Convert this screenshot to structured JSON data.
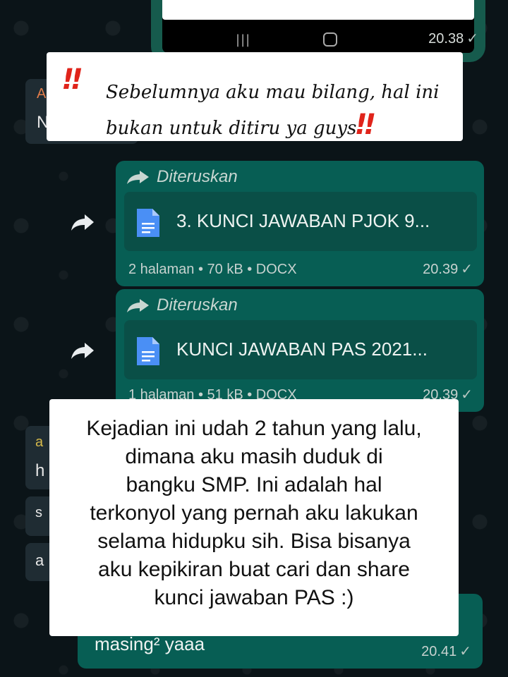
{
  "embedded_screenshot": {
    "nav_recents": "|||",
    "time": "20.38",
    "read_tick": "✓"
  },
  "incoming_fragments": {
    "top_sender_initial": "A",
    "top_text_initial": "N",
    "mid_sender_initial": "a",
    "mid_text_initial": "h",
    "lower_text_initial_1": "s",
    "lower_text_initial_2": "a"
  },
  "overlay_note_top": {
    "exclamation": "‼",
    "text_line_1": "Sebelumnya aku mau bilang, hal ini",
    "text_line_2": "bukan untuk ditiru ya guys"
  },
  "messages": [
    {
      "forwarded_label": "Diteruskan",
      "file_name": "3. KUNCI JAWABAN PJOK 9...",
      "meta": "2 halaman • 70 kB • DOCX",
      "time": "20.39",
      "tick": "✓"
    },
    {
      "forwarded_label": "Diteruskan",
      "file_name": "KUNCI JAWABAN PAS 2021...",
      "meta": "1 halaman • 51 kB • DOCX",
      "time": "20.39",
      "tick": "✓"
    }
  ],
  "overlay_note_main": {
    "lines": [
      "Kejadian ini udah 2 tahun yang lalu,",
      "dimana aku masih duduk di",
      "bangku SMP. Ini adalah hal",
      "terkonyol yang pernah aku lakukan",
      "selama hidupku sih. Bisa bisanya",
      "aku kepikiran buat cari dan share",
      "kunci jawaban PAS :)"
    ]
  },
  "last_message": {
    "text": "masing² yaaa",
    "time": "20.41",
    "tick": "✓"
  },
  "colors": {
    "chat_background": "#0b1418",
    "outgoing_bubble": "#075e54",
    "incoming_bubble": "#1f2c33",
    "warning_red": "#e0241b"
  },
  "icons": [
    "forward-arrow-icon",
    "share-icon",
    "document-icon",
    "read-tick-icon"
  ]
}
